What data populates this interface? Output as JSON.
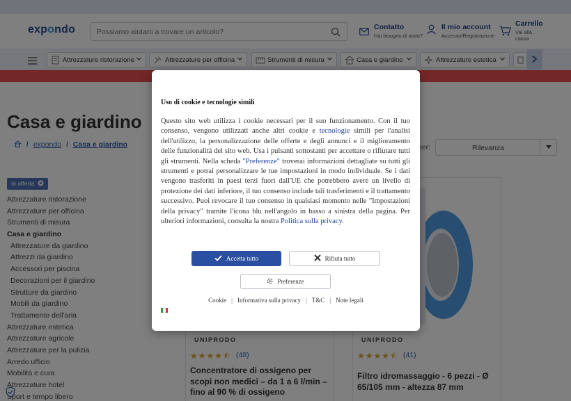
{
  "header": {
    "logo": {
      "part1": "exp",
      "part2": "o",
      "part3": "ndo"
    },
    "search_placeholder": "Possiamo aiutarti a trovare un articolo?",
    "contact": {
      "title": "Contatto",
      "subtitle": "Hai bisogno di aiuto?"
    },
    "account": {
      "title": "Il mio account",
      "subtitle": "Accesso/Registrazione"
    },
    "cart": {
      "title": "Carrello",
      "subtitle1": "Vai alla",
      "subtitle2": "cassa"
    }
  },
  "category_nav": [
    {
      "label": "Attrezzature ristorazione",
      "icon": "restaurant-icon"
    },
    {
      "label": "Attrezzature per officina",
      "icon": "workshop-icon"
    },
    {
      "label": "Strumenti di misura",
      "icon": "scale-icon"
    },
    {
      "label": "Casa e giardino",
      "icon": "house-icon"
    },
    {
      "label": "Attrezzature estetica",
      "icon": "sparkle-icon"
    }
  ],
  "page": {
    "title": "Casa e giardino",
    "breadcrumb": {
      "home": "expondo",
      "current": "Casa e giardino"
    },
    "offer_chip": "In offerta",
    "sort_label": "per:",
    "sort_value": "Rilevanza"
  },
  "sidebar": [
    {
      "label": "Attrezzature ristorazione",
      "level": 0
    },
    {
      "label": "Attrezzature per officina",
      "level": 0
    },
    {
      "label": "Strumenti di misura",
      "level": 0
    },
    {
      "label": "Casa e giardino",
      "level": 0,
      "active": true
    },
    {
      "label": "Attrezzature da giardino",
      "level": 1
    },
    {
      "label": "Attrezzi da giardino",
      "level": 1
    },
    {
      "label": "Accessori per piscina",
      "level": 1
    },
    {
      "label": "Decorazioni per il giardino",
      "level": 1
    },
    {
      "label": "Strutture da giardino",
      "level": 1
    },
    {
      "label": "Mobili da giardino",
      "level": 1
    },
    {
      "label": "Trattamento dell'aria",
      "level": 1
    },
    {
      "label": "Attrezzature estetica",
      "level": 0
    },
    {
      "label": "Attrezzature agricole",
      "level": 0
    },
    {
      "label": "Attrezzature per la pulizia",
      "level": 0
    },
    {
      "label": "Arredo ufficio",
      "level": 0
    },
    {
      "label": "Mobilità e cura",
      "level": 0
    },
    {
      "label": "Attrezzature hotel",
      "level": 0
    },
    {
      "label": "Sport e tempo libero",
      "level": 0
    }
  ],
  "products": [
    {
      "brand": "UNIPRODO",
      "stars": "★★★★⯪",
      "reviews": "(48)",
      "name": "Concentratore di ossigeno per scopi non medici – da 1 a 6 l/min – fino al 90 % di ossigeno"
    },
    {
      "brand": "UNIPRODO",
      "stars": "★★★★⯪",
      "reviews": "(41)",
      "name": "Filtro idromassaggio - 6 pezzi - Ø 65/105 mm - altezza 87 mm"
    }
  ],
  "cookie_modal": {
    "title": "Uso di cookie e tecnologie simili",
    "text_1": "Questo sito web utilizza i cookie necessari per il suo funzionamento. Con il tuo consenso, vengono utilizzati anche altri cookie e ",
    "link_tech": "tecnologie",
    "text_2": " simili per l'analisi dell'utilizzo, la personalizzazione delle offerte e degli annunci e il miglioramento delle funzionalità del sito web. Usa i pulsanti sottostanti per accettare o rifiutare tutti gli strumenti. Nella scheda ",
    "link_prefs": "\"Preferenze\"",
    "text_3": " troverai informazioni dettagliate su tutti gli strumenti e potrai personalizzare le tue impostazioni in modo individuale. Se i dati vengono trasferiti in paesi terzi fuori dall'UE che potrebbero avere un livello di protezione dei dati inferiore, il tuo consenso include tali trasferimenti e il trattamento successivo. Puoi revocare il tuo consenso in qualsiasi momento nelle \"Impostazioni della privacy\" tramite l'icona blu nell'angolo in basso a sinistra della pagina. Per ulteriori informazioni, consulta la nostra ",
    "link_policy": "Politica sulla privacy",
    "text_4": ".",
    "accept_label": "Accetta tutto",
    "reject_label": "Rifiuta tutto",
    "prefs_label": "Preferenze",
    "footer_links": [
      "Cookie",
      "Informativa sulla privacy",
      "T&C",
      "Note legali"
    ],
    "language_flag": "italian-flag-icon"
  },
  "colors": {
    "brand_blue": "#2d4d8f",
    "accent_blue": "#3c8fd0",
    "accept_button": "#2a4fa0",
    "promo_banner": "#e84f4f",
    "star_color": "#d8a232",
    "filter_blue": "#4f9be0"
  }
}
